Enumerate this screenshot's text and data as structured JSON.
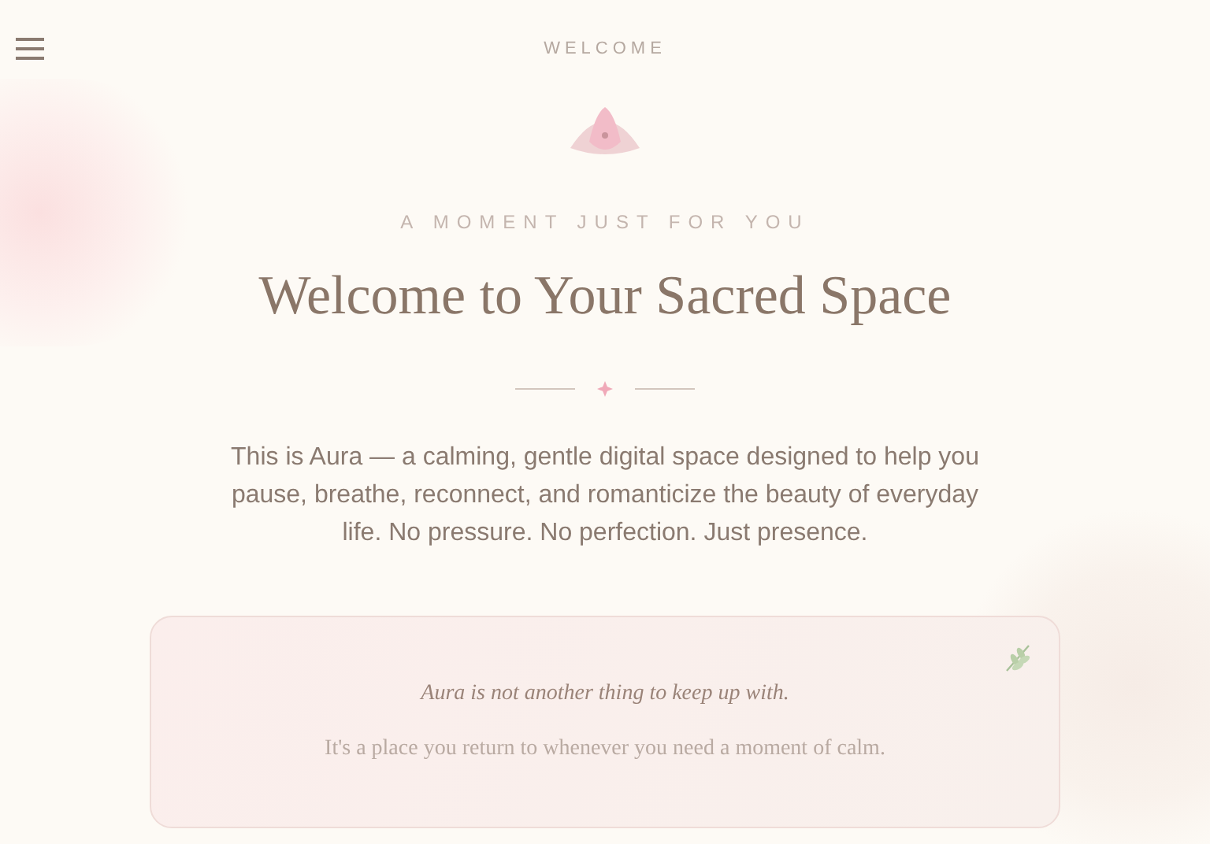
{
  "header": {
    "title": "WELCOME"
  },
  "intro": {
    "eyebrow": "A MOMENT JUST FOR YOU",
    "heading": "Welcome to Your Sacred Space",
    "body": "This is Aura — a calming, gentle digital space designed to help you pause, breathe, reconnect, and romanticize the beauty of everyday life. No pressure. No perfection. Just presence."
  },
  "card": {
    "lines": [
      {
        "kind": "emphasis",
        "text": "Aura is not another thing to keep up with."
      },
      {
        "kind": "plain",
        "text": "It's a place you return to whenever you need a moment of calm."
      }
    ]
  }
}
